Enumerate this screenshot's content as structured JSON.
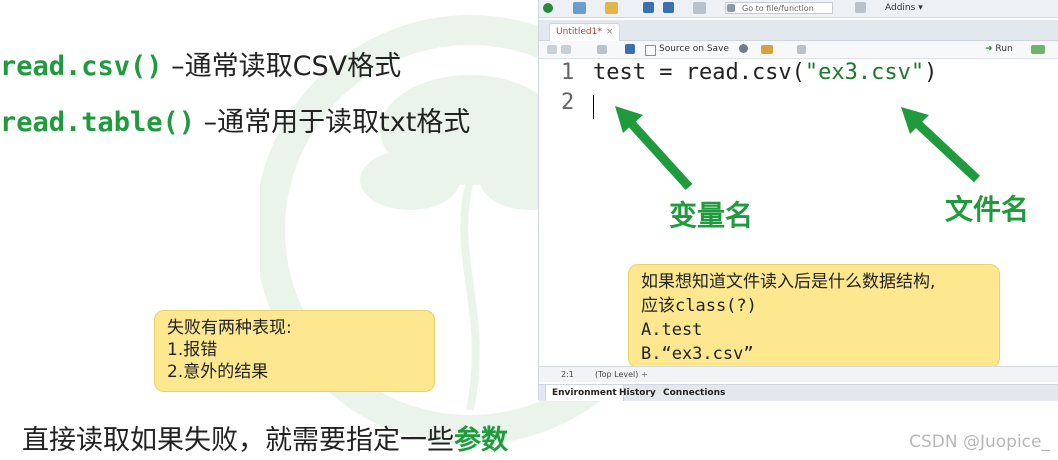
{
  "slide": {
    "line1_code": "read.csv()",
    "line1_desc": "  –通常读取CSV格式",
    "line2_code": "read.table()",
    "line2_desc": " –通常用于读取txt格式",
    "fail_note": [
      "失败有两种表现:",
      "1.报错",
      "2.意外的结果"
    ],
    "bottom_text": "直接读取如果失败，就需要指定一些",
    "bottom_highlight": "参数",
    "credit": "CSDN @Juopice_"
  },
  "rstudio": {
    "goto_placeholder": "Go to file/function",
    "addins_label": "Addins",
    "tab_title": "Untitled1*",
    "tab_close": "×",
    "source_on_save": "Source on Save",
    "run_label": "Run",
    "editor": {
      "line_numbers": [
        "1",
        "2"
      ],
      "code_var": "test = read.csv(",
      "code_str": "\"ex3.csv\"",
      "code_end": ")"
    },
    "annotations": {
      "var_label": "变量名",
      "file_label": "文件名",
      "class_note": [
        "如果想知道文件读入后是什么数据结构,",
        "应该class(?)",
        "A.test",
        "B.“ex3.csv”"
      ]
    },
    "status": {
      "position": "2:1",
      "level": "(Top Level) ÷"
    },
    "pane_tabs": [
      "Environment",
      "History",
      "Connections"
    ]
  },
  "colors": {
    "accent_green": "#1f9a3c",
    "note_yellow": "#fde78f",
    "tab_red": "#c43b2d"
  }
}
